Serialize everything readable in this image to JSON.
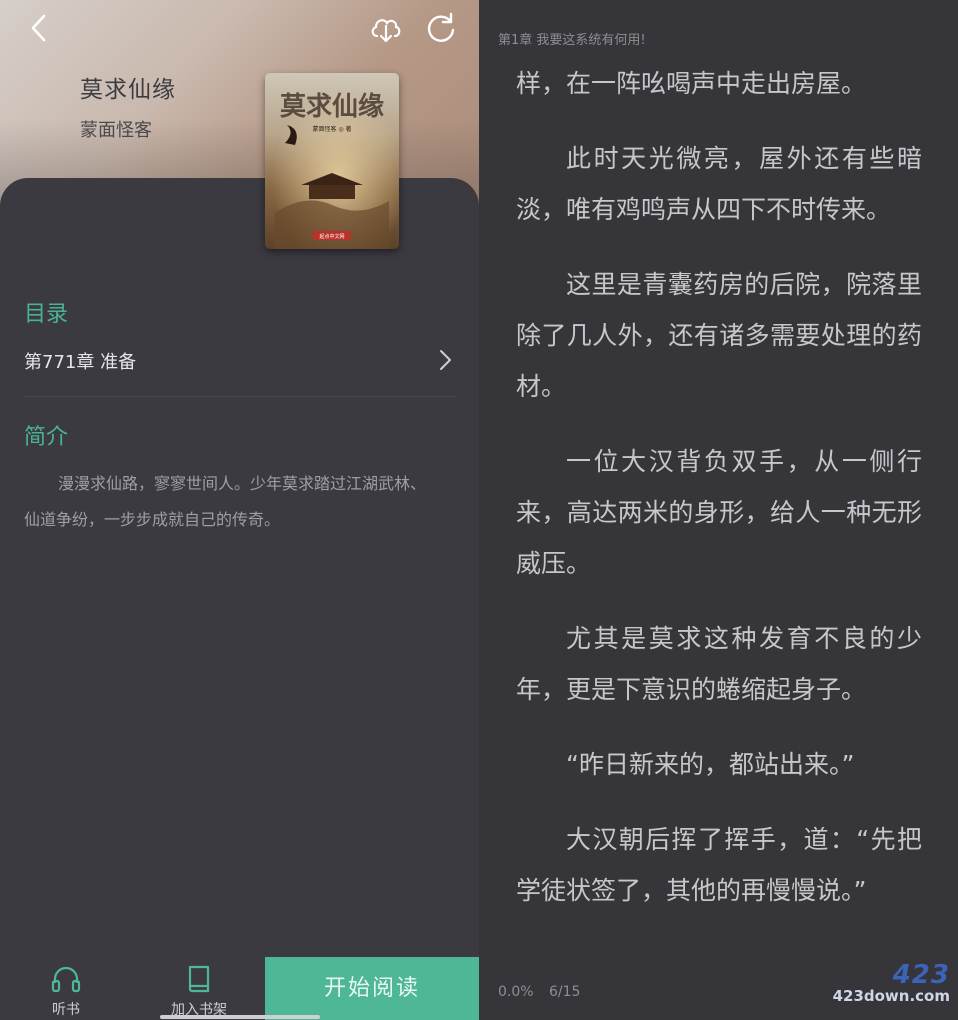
{
  "colors": {
    "accent": "#4eb798",
    "background": "#3a3a40",
    "reader_bg": "#35353a"
  },
  "detail": {
    "back_icon": "chevron-left-icon",
    "download_icon": "cloud-download-icon",
    "refresh_icon": "refresh-icon",
    "title": "莫求仙缘",
    "author": "蒙面怪客",
    "toc_heading": "目录",
    "latest_chapter": "第771章 准备",
    "intro_heading": "简介",
    "intro": "漫漫求仙路，寥寥世间人。少年莫求踏过江湖武林、仙道争纷，一步步成就自己的传奇。",
    "listen_label": "听书",
    "shelf_label": "加入书架",
    "start_label": "开始阅读"
  },
  "reader": {
    "chapter_header": "第1章 我要这系统有何用!",
    "paragraphs": [
      "样，在一阵吆喝声中走出房屋。",
      "此时天光微亮，屋外还有些暗淡，唯有鸡鸣声从四下不时传来。",
      "这里是青囊药房的后院，院落里除了几人外，还有诸多需要处理的药材。",
      "一位大汉背负双手，从一侧行来，高达两米的身形，给人一种无形威压。",
      "尤其是莫求这种发育不良的少年，更是下意识的蜷缩起身子。",
      "“昨日新来的，都站出来。”",
      "大汉朝后挥了挥手，道：“先把学徒状签了，其他的再慢慢说。”"
    ],
    "progress": "0.0%",
    "page": "6/15"
  },
  "watermark": {
    "logo": "423",
    "site": "423down.com"
  }
}
